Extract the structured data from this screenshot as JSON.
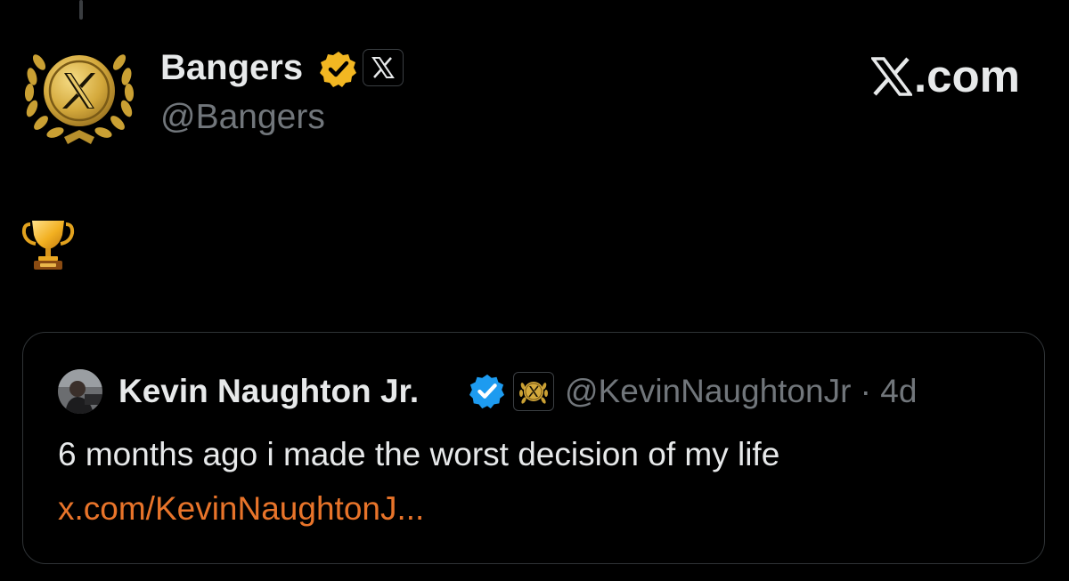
{
  "colors": {
    "background": "#000000",
    "primary_text": "#e7e9ea",
    "secondary_text": "#71767b",
    "link": "#e8742a",
    "verified_gold": "#f2b722",
    "verified_blue": "#1d9bf0",
    "gold_emblem": "#d4a93c",
    "card_border": "#2f3336"
  },
  "post": {
    "author": {
      "name": "Bangers",
      "handle": "@Bangers",
      "avatar_icon": "gold-x-laurel-emblem-icon",
      "verified_icon": "gold-verified-badge-icon",
      "affiliation_icon": "x-logo-affiliate-badge-icon"
    },
    "site_label": "X.com",
    "body_icon": "trophy-icon"
  },
  "quote": {
    "author_name": "Kevin Naughton Jr.",
    "verified_icon": "blue-verified-badge-icon",
    "affiliation_icon": "gold-x-laurel-affiliate-icon",
    "handle": "@KevinNaughtonJr",
    "separator": "·",
    "age": "4d",
    "meta": "@KevinNaughtonJr · 4d",
    "text": "6 months ago i made the worst decision of my life",
    "link": "x.com/KevinNaughtonJ..."
  }
}
